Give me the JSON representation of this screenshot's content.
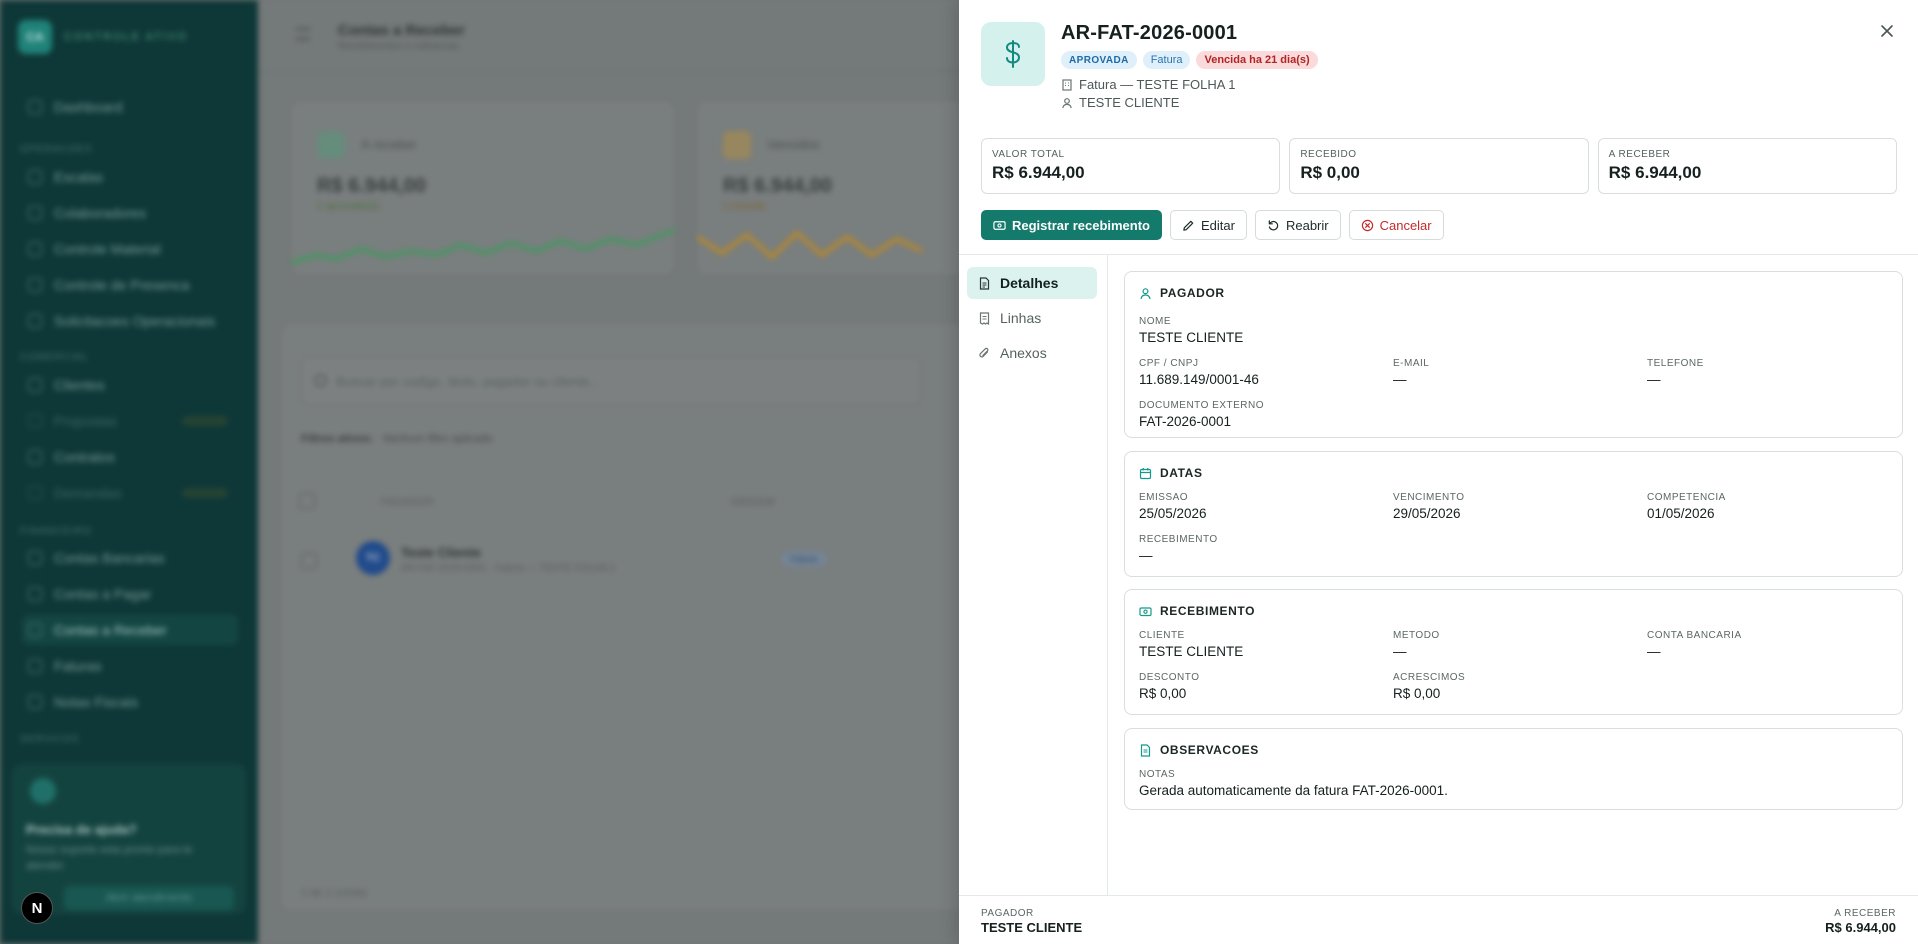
{
  "background": {
    "brand": {
      "logo": "CA",
      "name": "CONTROLE ATIVO"
    },
    "sidebar": {
      "sections": [
        "OPERACOES",
        "COMERCIAL",
        "FINANCEIRO",
        "SERVICOS"
      ],
      "items": [
        {
          "label": "Dashboard"
        },
        {
          "label": "Escalas"
        },
        {
          "label": "Colaboradores"
        },
        {
          "label": "Controle Material"
        },
        {
          "label": "Controle de Presenca"
        },
        {
          "label": "Solicitacoes Operacionais"
        },
        {
          "label": "Clientes"
        },
        {
          "label": "Propostas"
        },
        {
          "label": "Contratos"
        },
        {
          "label": "Demandas"
        },
        {
          "label": "Contas Bancarias"
        },
        {
          "label": "Contas a Pagar"
        },
        {
          "label": "Contas a Receber"
        },
        {
          "label": "Faturas"
        },
        {
          "label": "Notas Fiscais"
        }
      ],
      "help": {
        "title": "Precisa de ajuda?",
        "text": "Nosso suporte esta pronto para te atender.",
        "button": "Abrir atendimento"
      }
    },
    "header": {
      "title": "Contas a Receber",
      "subtitle": "Recebimentos e cobrancas"
    },
    "kpis": [
      {
        "label": "A receber",
        "value": "R$ 6.944,00",
        "sub": "1 aprovado(s)",
        "color": "#1f9a70"
      },
      {
        "label": "Vencidos",
        "value": "R$ 6.944,00",
        "sub": "1 vencido",
        "color": "#d99a2b"
      }
    ],
    "search_placeholder": "Buscar por codigo, titulo, pagador ou cliente...",
    "filters": {
      "label": "Filtros ativos:",
      "value": "Nenhum filtro aplicado"
    },
    "table": {
      "columns": [
        "PAGADOR",
        "ORIGEM"
      ]
    },
    "row": {
      "avatar": "TC",
      "name": "Teste Cliente",
      "sub": "AR-FAT-2026-0001 · Fatura — TESTE FOLHA 1",
      "badge": "Fatura"
    },
    "footer_count": "1 de 1 contas"
  },
  "drawer": {
    "title": "AR-FAT-2026-0001",
    "badges": {
      "status": "APROVADA",
      "type": "Fatura",
      "overdue": "Vencida ha 21 dia(s)"
    },
    "source": "Fatura — TESTE FOLHA 1",
    "client": "TESTE CLIENTE",
    "stats": [
      {
        "label": "VALOR TOTAL",
        "value": "R$ 6.944,00"
      },
      {
        "label": "RECEBIDO",
        "value": "R$ 0,00"
      },
      {
        "label": "A RECEBER",
        "value": "R$ 6.944,00"
      }
    ],
    "actions": {
      "register": "Registrar recebimento",
      "edit": "Editar",
      "reopen": "Reabrir",
      "cancel": "Cancelar"
    },
    "tabs": [
      "Detalhes",
      "Linhas",
      "Anexos"
    ],
    "pagador": {
      "title": "PAGADOR",
      "name_label": "NOME",
      "name": "TESTE CLIENTE",
      "doc_label": "CPF / CNPJ",
      "doc": "11.689.149/0001-46",
      "email_label": "E-MAIL",
      "email": "—",
      "phone_label": "TELEFONE",
      "phone": "—",
      "ext_label": "DOCUMENTO EXTERNO",
      "ext": "FAT-2026-0001"
    },
    "datas": {
      "title": "DATAS",
      "emissao_label": "EMISSAO",
      "emissao": "25/05/2026",
      "vencimento_label": "VENCIMENTO",
      "vencimento": "29/05/2026",
      "competencia_label": "COMPETENCIA",
      "competencia": "01/05/2026",
      "recebimento_label": "RECEBIMENTO",
      "recebimento": "—"
    },
    "recebimento": {
      "title": "RECEBIMENTO",
      "cliente_label": "CLIENTE",
      "cliente": "TESTE CLIENTE",
      "metodo_label": "METODO",
      "metodo": "—",
      "conta_label": "CONTA BANCARIA",
      "conta": "—",
      "desconto_label": "DESCONTO",
      "desconto": "R$ 0,00",
      "acrescimos_label": "ACRESCIMOS",
      "acrescimos": "R$ 0,00"
    },
    "observacoes": {
      "title": "OBSERVACOES",
      "notas_label": "NOTAS",
      "notas": "Gerada automaticamente da fatura FAT-2026-0001."
    },
    "footer": {
      "left_label": "PAGADOR",
      "left_value": "TESTE CLIENTE",
      "right_label": "A RECEBER",
      "right_value": "R$ 6.944,00"
    }
  }
}
